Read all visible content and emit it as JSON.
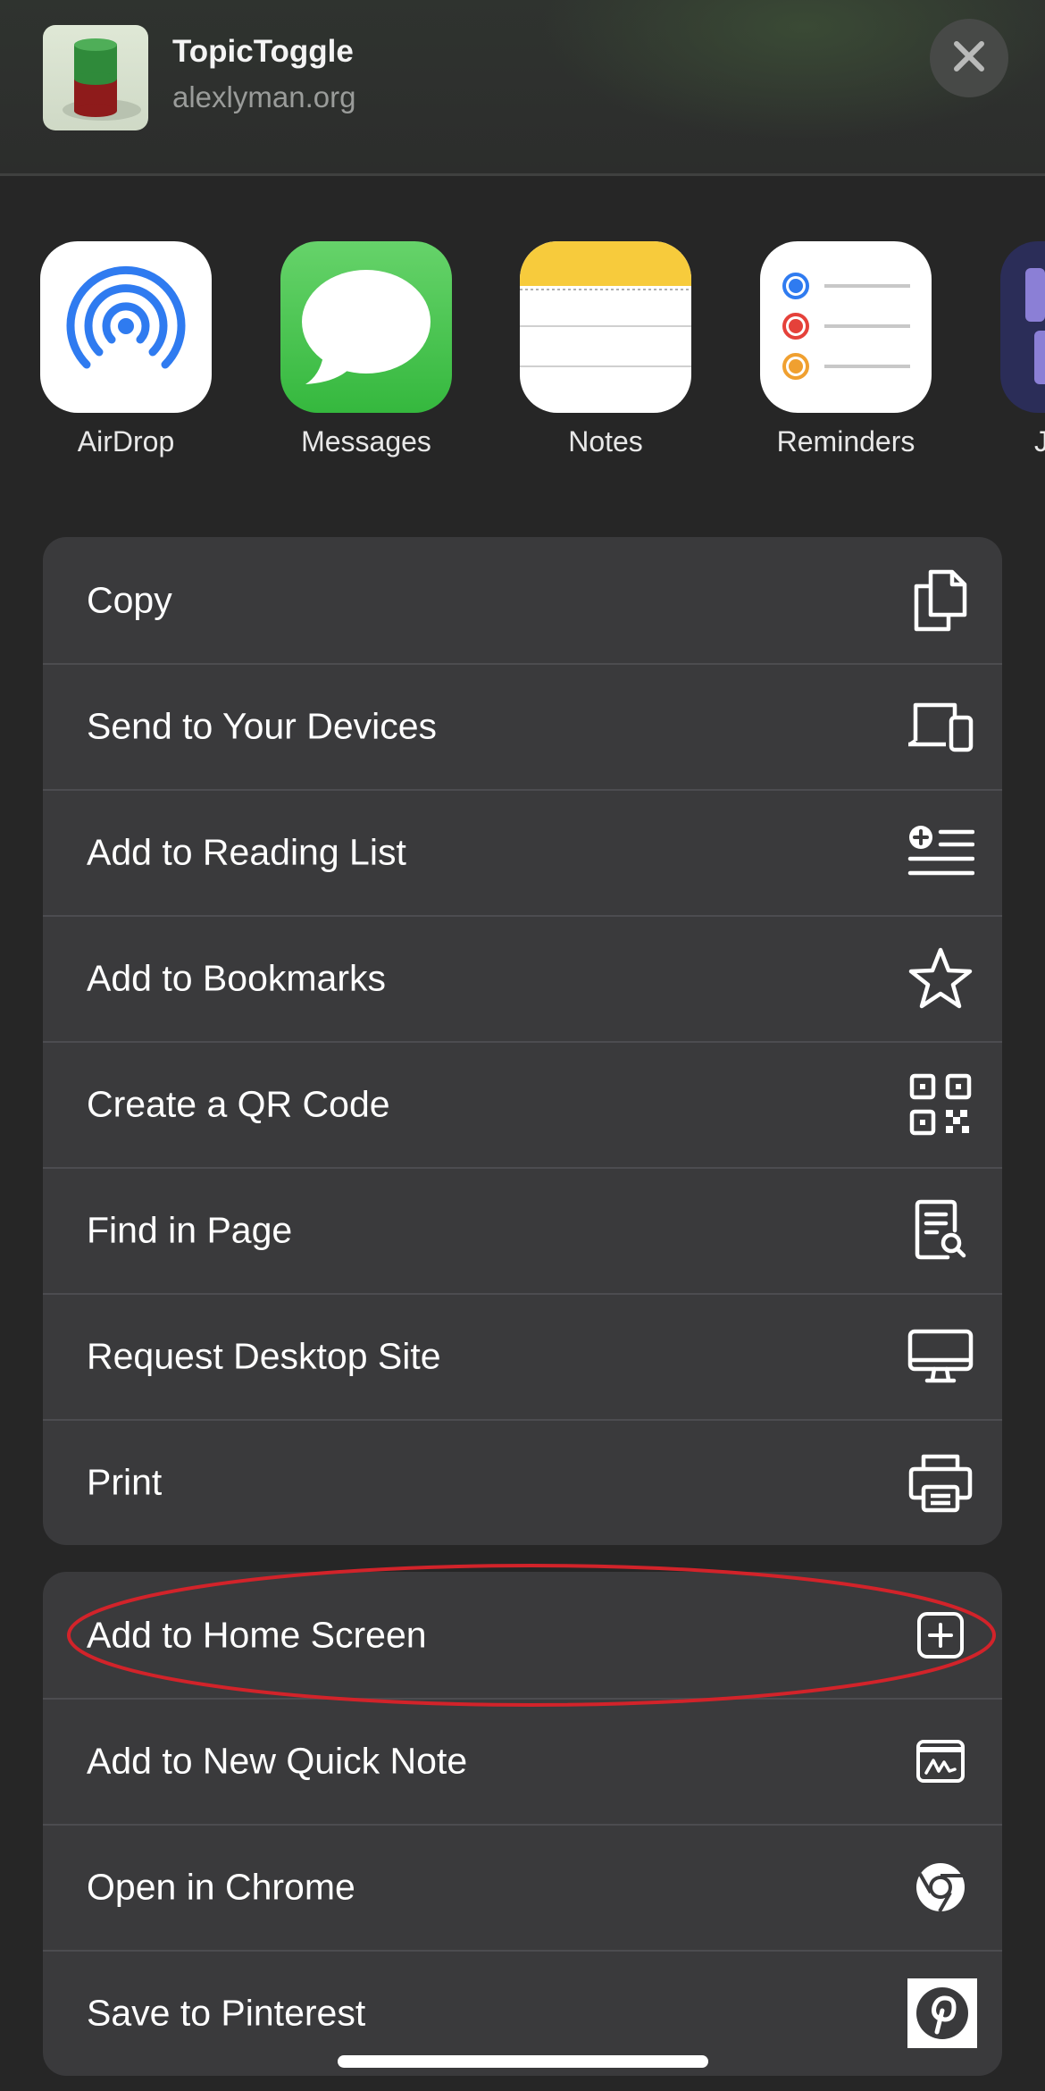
{
  "header": {
    "site_title": "TopicToggle",
    "site_url": "alexlyman.org",
    "close_icon": "close-icon"
  },
  "apps": [
    {
      "label": "AirDrop",
      "icon": "airdrop-icon",
      "color": "#ffffff"
    },
    {
      "label": "Messages",
      "icon": "messages-icon",
      "color": "#34c759"
    },
    {
      "label": "Notes",
      "icon": "notes-icon",
      "color": "#f7cb3c"
    },
    {
      "label": "Reminders",
      "icon": "reminders-icon",
      "color": "#ffffff"
    },
    {
      "label": "J",
      "icon": "partial-app-icon",
      "color": "#2b2d58"
    }
  ],
  "actions_group_1": [
    {
      "label": "Copy",
      "icon": "copy-icon"
    },
    {
      "label": "Send to Your Devices",
      "icon": "devices-icon"
    },
    {
      "label": "Add to Reading List",
      "icon": "reading-list-icon"
    },
    {
      "label": "Add to Bookmarks",
      "icon": "star-icon"
    },
    {
      "label": "Create a QR Code",
      "icon": "qr-code-icon"
    },
    {
      "label": "Find in Page",
      "icon": "find-in-page-icon"
    },
    {
      "label": "Request Desktop Site",
      "icon": "desktop-icon"
    },
    {
      "label": "Print",
      "icon": "printer-icon"
    }
  ],
  "actions_group_2": [
    {
      "label": "Add to Home Screen",
      "icon": "add-square-icon",
      "highlighted": true
    },
    {
      "label": "Add to New Quick Note",
      "icon": "quick-note-icon"
    },
    {
      "label": "Open in Chrome",
      "icon": "chrome-icon"
    },
    {
      "label": "Save to Pinterest",
      "icon": "pinterest-icon"
    }
  ],
  "colors": {
    "background": "#262626",
    "list_background": "#3a3a3c",
    "highlight": "#d2232a"
  }
}
